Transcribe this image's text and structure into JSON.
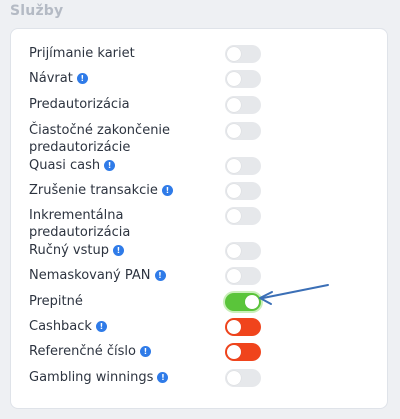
{
  "section": {
    "title": "Služby"
  },
  "services": [
    {
      "label": "Prijímanie kariet",
      "info": false,
      "enabled": false
    },
    {
      "label": "Návrat",
      "info": true,
      "enabled": false
    },
    {
      "label": "Predautorizácia",
      "info": false,
      "enabled": false
    },
    {
      "label": "Čiastočné zakončenie predautorizácie",
      "info": false,
      "enabled": false
    },
    {
      "label": "Quasi cash",
      "info": true,
      "enabled": false
    },
    {
      "label": "Zrušenie transakcie",
      "info": true,
      "enabled": false
    },
    {
      "label": "Inkrementálna predautorizácia",
      "info": false,
      "enabled": false
    },
    {
      "label": "Ručný vstup",
      "info": true,
      "enabled": false
    },
    {
      "label": "Nemaskovaný PAN",
      "info": true,
      "enabled": false
    },
    {
      "label": "Prepitné",
      "info": false,
      "enabled": true
    },
    {
      "label": "Cashback",
      "info": true,
      "enabled": false
    },
    {
      "label": "Referenčné číslo",
      "info": true,
      "enabled": false
    },
    {
      "label": "Gambling winnings",
      "info": true,
      "enabled": false
    }
  ],
  "info_icon_glyph": "!",
  "colors": {
    "toggle_off": "#e6e8eb",
    "toggle_on": "#5ac53a",
    "toggle_alert": "#f0441c",
    "info_icon": "#2f7be8",
    "arrow": "#3b6fb6"
  }
}
